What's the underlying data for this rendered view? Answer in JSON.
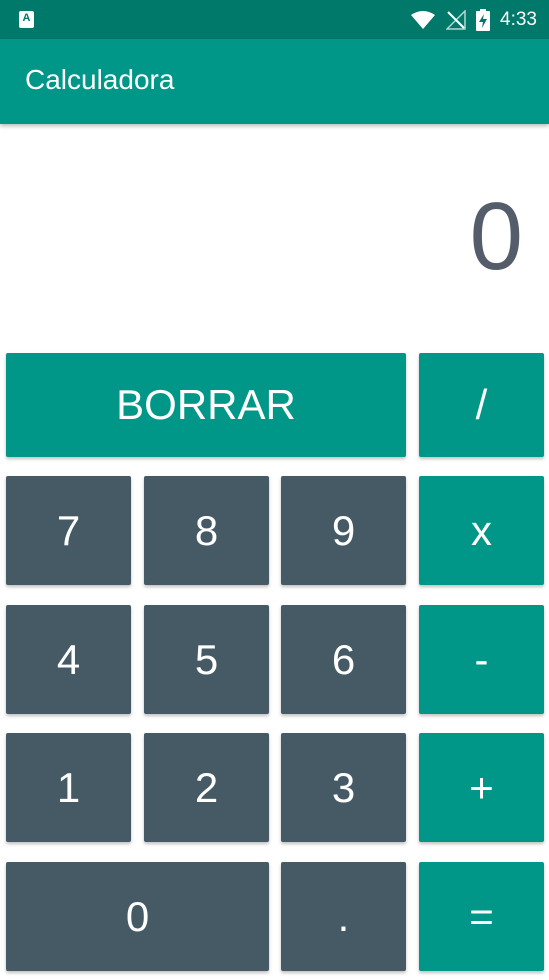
{
  "status_bar": {
    "time": "4:33",
    "app_icon_letter": "A"
  },
  "app_bar": {
    "title": "Calculadora"
  },
  "display": {
    "value": "0"
  },
  "buttons": {
    "clear": "BORRAR",
    "divide": "/",
    "multiply": "x",
    "subtract": "-",
    "add": "+",
    "equals": "=",
    "d7": "7",
    "d8": "8",
    "d9": "9",
    "d4": "4",
    "d5": "5",
    "d6": "6",
    "d1": "1",
    "d2": "2",
    "d3": "3",
    "d0": "0",
    "decimal": "."
  },
  "colors": {
    "status_bar": "#00796b",
    "app_bar": "#009688",
    "operator_button": "#009688",
    "digit_button": "#455a64",
    "display_text": "#555d6a"
  }
}
